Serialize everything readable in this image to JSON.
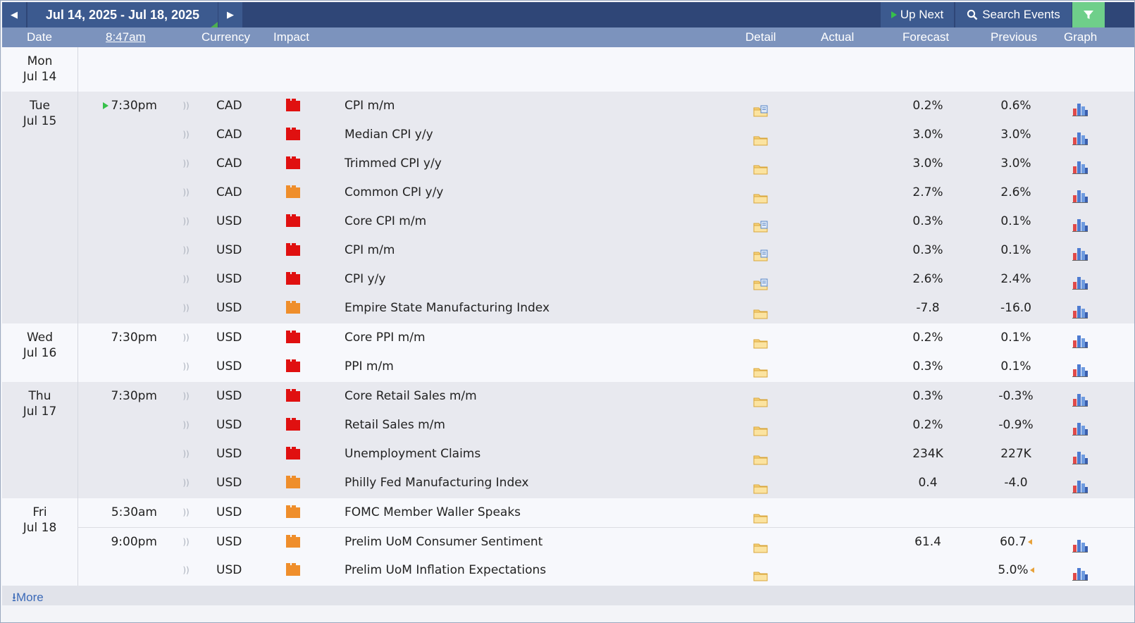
{
  "nav": {
    "date_range": "Jul 14, 2025 - Jul 18, 2025",
    "prev_icon": "triangle-left-icon",
    "next_icon": "triangle-right-icon",
    "up_next_label": "Up Next",
    "search_label": "Search Events",
    "filter_icon": "filter-funnel-icon"
  },
  "columns": {
    "date": "Date",
    "time": "8:47am",
    "currency": "Currency",
    "impact": "Impact",
    "detail": "Detail",
    "actual": "Actual",
    "forecast": "Forecast",
    "previous": "Previous",
    "graph": "Graph"
  },
  "colors": {
    "high_impact": "#e01010",
    "medium_impact": "#ef8e2b",
    "header_bg": "#2f4677",
    "subheader_bg": "#7c93bd"
  },
  "days": [
    {
      "day": "Mon",
      "date": "Jul 14",
      "events": []
    },
    {
      "day": "Tue",
      "date": "Jul 15",
      "events": [
        {
          "time": "7:30pm",
          "upcoming": true,
          "currency": "CAD",
          "impact": "high",
          "event": "CPI m/m",
          "detail": "detail-folder-with-news-icon",
          "actual": "",
          "forecast": "0.2%",
          "previous": "0.6%",
          "graph": true
        },
        {
          "time": "",
          "currency": "CAD",
          "impact": "high",
          "event": "Median CPI y/y",
          "detail": "detail-folder-icon",
          "actual": "",
          "forecast": "3.0%",
          "previous": "3.0%",
          "graph": true
        },
        {
          "time": "",
          "currency": "CAD",
          "impact": "high",
          "event": "Trimmed CPI y/y",
          "detail": "detail-folder-icon",
          "actual": "",
          "forecast": "3.0%",
          "previous": "3.0%",
          "graph": true
        },
        {
          "time": "",
          "currency": "CAD",
          "impact": "medium",
          "event": "Common CPI y/y",
          "detail": "detail-folder-icon",
          "actual": "",
          "forecast": "2.7%",
          "previous": "2.6%",
          "graph": true
        },
        {
          "time": "",
          "currency": "USD",
          "impact": "high",
          "event": "Core CPI m/m",
          "detail": "detail-folder-with-news-icon",
          "actual": "",
          "forecast": "0.3%",
          "previous": "0.1%",
          "graph": true
        },
        {
          "time": "",
          "currency": "USD",
          "impact": "high",
          "event": "CPI m/m",
          "detail": "detail-folder-with-news-icon",
          "actual": "",
          "forecast": "0.3%",
          "previous": "0.1%",
          "graph": true
        },
        {
          "time": "",
          "currency": "USD",
          "impact": "high",
          "event": "CPI y/y",
          "detail": "detail-folder-with-news-icon",
          "actual": "",
          "forecast": "2.6%",
          "previous": "2.4%",
          "graph": true
        },
        {
          "time": "",
          "currency": "USD",
          "impact": "medium",
          "event": "Empire State Manufacturing Index",
          "detail": "detail-folder-icon",
          "actual": "",
          "forecast": "-7.8",
          "previous": "-16.0",
          "graph": true
        }
      ]
    },
    {
      "day": "Wed",
      "date": "Jul 16",
      "events": [
        {
          "time": "7:30pm",
          "currency": "USD",
          "impact": "high",
          "event": "Core PPI m/m",
          "detail": "detail-folder-icon",
          "actual": "",
          "forecast": "0.2%",
          "previous": "0.1%",
          "graph": true
        },
        {
          "time": "",
          "currency": "USD",
          "impact": "high",
          "event": "PPI m/m",
          "detail": "detail-folder-icon",
          "actual": "",
          "forecast": "0.3%",
          "previous": "0.1%",
          "graph": true
        }
      ]
    },
    {
      "day": "Thu",
      "date": "Jul 17",
      "events": [
        {
          "time": "7:30pm",
          "currency": "USD",
          "impact": "high",
          "event": "Core Retail Sales m/m",
          "detail": "detail-folder-icon",
          "actual": "",
          "forecast": "0.3%",
          "previous": "-0.3%",
          "graph": true
        },
        {
          "time": "",
          "currency": "USD",
          "impact": "high",
          "event": "Retail Sales m/m",
          "detail": "detail-folder-icon",
          "actual": "",
          "forecast": "0.2%",
          "previous": "-0.9%",
          "graph": true
        },
        {
          "time": "",
          "currency": "USD",
          "impact": "high",
          "event": "Unemployment Claims",
          "detail": "detail-folder-icon",
          "actual": "",
          "forecast": "234K",
          "previous": "227K",
          "graph": true
        },
        {
          "time": "",
          "currency": "USD",
          "impact": "medium",
          "event": "Philly Fed Manufacturing Index",
          "detail": "detail-folder-icon",
          "actual": "",
          "forecast": "0.4",
          "previous": "-4.0",
          "graph": true
        }
      ]
    },
    {
      "day": "Fri",
      "date": "Jul 18",
      "events": [
        {
          "time": "5:30am",
          "currency": "USD",
          "impact": "medium",
          "event": "FOMC Member Waller Speaks",
          "detail": "detail-folder-icon",
          "actual": "",
          "forecast": "",
          "previous": "",
          "graph": false
        },
        {
          "time": "9:00pm",
          "currency": "USD",
          "impact": "medium",
          "event": "Prelim UoM Consumer Sentiment",
          "detail": "detail-folder-icon",
          "actual": "",
          "forecast": "61.4",
          "previous": "60.7",
          "revised": true,
          "graph": true
        },
        {
          "time": "",
          "currency": "USD",
          "impact": "medium",
          "event": "Prelim UoM Inflation Expectations",
          "detail": "detail-folder-icon",
          "actual": "",
          "forecast": "",
          "previous": "5.0%",
          "revised": true,
          "graph": true
        }
      ]
    }
  ],
  "footer": {
    "more_label": "More",
    "more_icon": "download-arrow-icon"
  }
}
